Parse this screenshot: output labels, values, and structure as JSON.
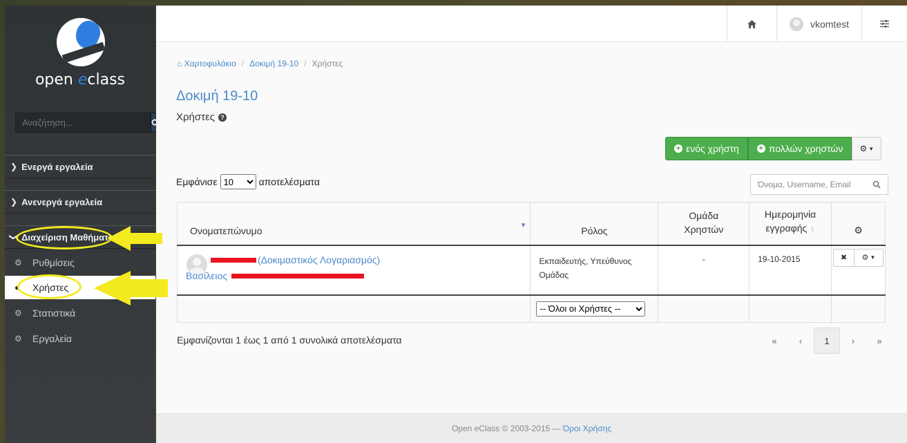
{
  "brand": {
    "name_prefix": "open ",
    "name_e": "e",
    "name_suffix": "class"
  },
  "sidebar": {
    "search_placeholder": "Αναζήτηση...",
    "sections": [
      {
        "label": "Ενεργά εργαλεία"
      },
      {
        "label": "Ανενεργά εργαλεία"
      },
      {
        "label": "Διαχείριση Μαθήματος"
      }
    ],
    "items": [
      {
        "label": "Ρυθμίσεις",
        "icon": "gears-icon"
      },
      {
        "label": "Χρήστες",
        "icon": "user-icon",
        "active": true
      },
      {
        "label": "Στατιστικά",
        "icon": "gears-icon"
      },
      {
        "label": "Εργαλεία",
        "icon": "gears-icon"
      }
    ]
  },
  "topbar": {
    "username": "vkomtest"
  },
  "breadcrumb": [
    "Χαρτοφυλάκιο",
    "Δοκιμή 19-10",
    "Χρήστες"
  ],
  "course_title": "Δοκιμή 19-10",
  "page_title": "Χρήστες",
  "actions": {
    "add_one": "ενός χρήστη",
    "add_many": "πολλών χρηστών"
  },
  "table_controls": {
    "show_prefix": "Εμφάνισε",
    "show_value": "10",
    "show_suffix": "αποτελέσματα",
    "filter_placeholder": "Όνομα, Username, Email"
  },
  "table": {
    "headers": [
      "Ονοματεπώνυμο",
      "Ρόλος",
      "Ομάδα Χρηστών",
      "Ημερομηνία εγγραφής"
    ],
    "header_group_line1": "Ομάδα",
    "header_group_line2": "Χρηστών",
    "header_date_line1": "Ημερομηνία",
    "header_date_line2": "εγγραφής",
    "rows": [
      {
        "name_suffix": "(Δοκιμαστικός Λογαριασμός)",
        "first_name": "Βασίλειος",
        "role": "Εκπαιδευτής, Υπεύθυνος Ομάδας",
        "group": "-",
        "date": "19-10-2015"
      }
    ],
    "role_filter": "-- Όλοι οι Χρήστες --"
  },
  "info": "Εμφανίζονται 1 έως 1 από 1 συνολικά αποτελέσματα",
  "pager": {
    "first": "«",
    "prev": "‹",
    "current": "1",
    "next": "›",
    "last": "»"
  },
  "footer": {
    "copyright": "Open eClass © 2003-2015 — ",
    "terms": "Όροι Χρήσης"
  },
  "colors": {
    "accent": "#4a8bc9",
    "success": "#4cae4c",
    "highlight": "#f4ea20",
    "redaction": "#e8141e"
  }
}
